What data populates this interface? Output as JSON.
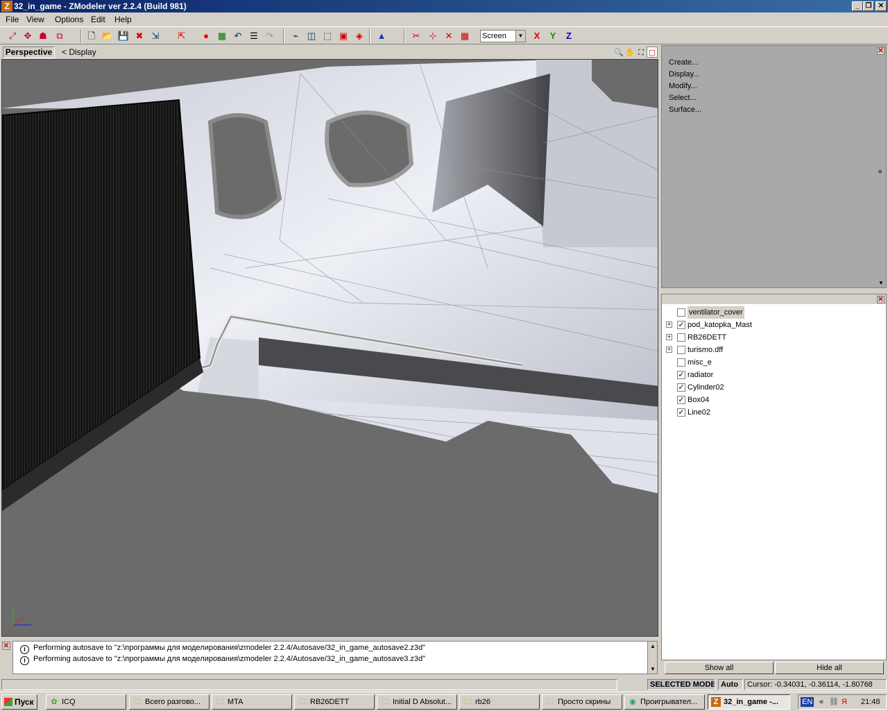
{
  "window": {
    "title": "32_in_game - ZModeler ver 2.2.4 (Build 981)",
    "app_icon": "Z",
    "buttons": [
      "minimize",
      "restore",
      "close"
    ]
  },
  "menu": [
    "File",
    "View",
    "Options",
    "Edit",
    "Help"
  ],
  "toolbar": {
    "view_select": "Screen",
    "axes": [
      "X",
      "Y",
      "Z"
    ]
  },
  "viewport": {
    "mode": "Perspective",
    "display_menu": "< Display"
  },
  "command_panel": {
    "items": [
      "Create...",
      "Display...",
      "Modify...",
      "Select...",
      "Surface..."
    ]
  },
  "objects": [
    {
      "name": "ventilator_cover",
      "checked": false,
      "expandable": false,
      "selected": true
    },
    {
      "name": "pod_katopka_Mast",
      "checked": true,
      "expandable": true
    },
    {
      "name": "RB26DETT",
      "checked": false,
      "expandable": true
    },
    {
      "name": "turismo.dff",
      "checked": false,
      "expandable": true
    },
    {
      "name": "misc_e",
      "checked": false,
      "expandable": false
    },
    {
      "name": "radiator",
      "checked": true,
      "expandable": false
    },
    {
      "name": "Cylinder02",
      "checked": true,
      "expandable": false
    },
    {
      "name": "Box04",
      "checked": true,
      "expandable": false
    },
    {
      "name": "Line02",
      "checked": true,
      "expandable": false
    }
  ],
  "panel_buttons": {
    "show_all": "Show all",
    "hide_all": "Hide all"
  },
  "log": [
    "Performing autosave to \"z:\\программы для моделирования\\zmodeler 2.2.4/Autosave/32_in_game_autosave2.z3d\"",
    "Performing autosave to \"z:\\программы для моделирования\\zmodeler 2.2.4/Autosave/32_in_game_autosave3.z3d\""
  ],
  "status": {
    "mode": "SELECTED MODE",
    "auto": "Auto",
    "cursor": "Cursor: -0.34031, -0.36114, -1.80768"
  },
  "taskbar": {
    "start": "Пуск",
    "tasks": [
      "ICQ",
      "Всего разгово...",
      "MTA",
      "RB26DETT",
      "Initial D Absolut...",
      "rb26",
      "Просто скрины",
      "Проигрывател...",
      "32_in_game -..."
    ],
    "lang": "EN",
    "clock": "21:48"
  }
}
